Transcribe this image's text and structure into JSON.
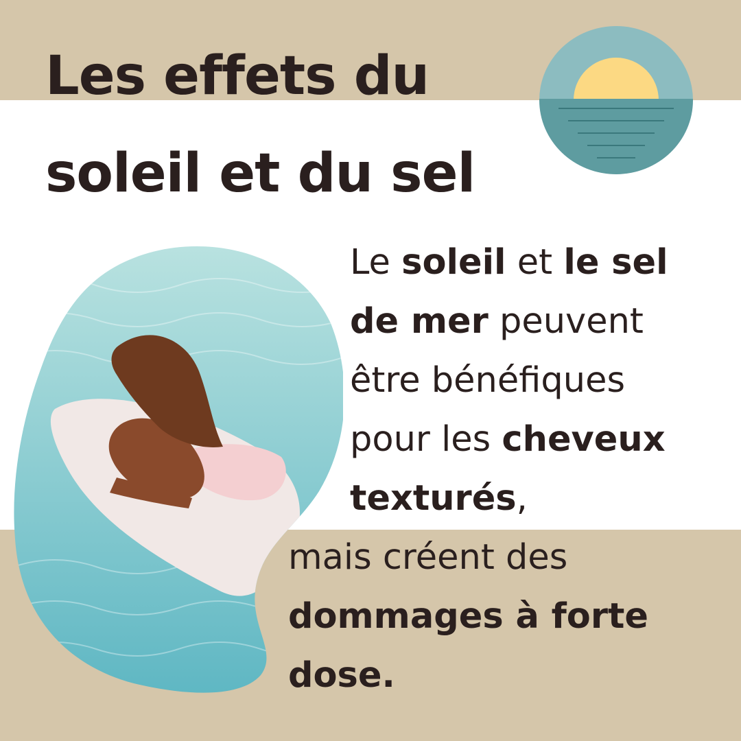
{
  "colors": {
    "band": "#d5c6aa",
    "text": "#2a1f1e",
    "sky": "#8cbcc0",
    "sun": "#fcd983",
    "sea": "#5e9ca0",
    "sea_lines": "#2f6c70",
    "water_light": "#b9e2e0",
    "water_deep": "#5fb7c3",
    "skin": "#8a4a2c",
    "hair": "#6e3a1f",
    "board": "#f1e8e6",
    "swimsuit": "#f4cfd1"
  },
  "title": {
    "line1": "Les effets du",
    "line2": "soleil et du sel"
  },
  "icons": {
    "badge": "sunset-over-sea-icon",
    "photo": "woman-on-surfboard-photo"
  },
  "copy": {
    "l1": [
      "Le ",
      "soleil",
      " et ",
      "le sel"
    ],
    "l2": [
      "de mer",
      " peuvent"
    ],
    "l3": "être bénéfiques",
    "l4": [
      "pour les ",
      "cheveux"
    ],
    "l5": [
      "texturés",
      ","
    ],
    "l6": "mais créent des",
    "l7": "dommages à forte",
    "l8": "dose."
  }
}
